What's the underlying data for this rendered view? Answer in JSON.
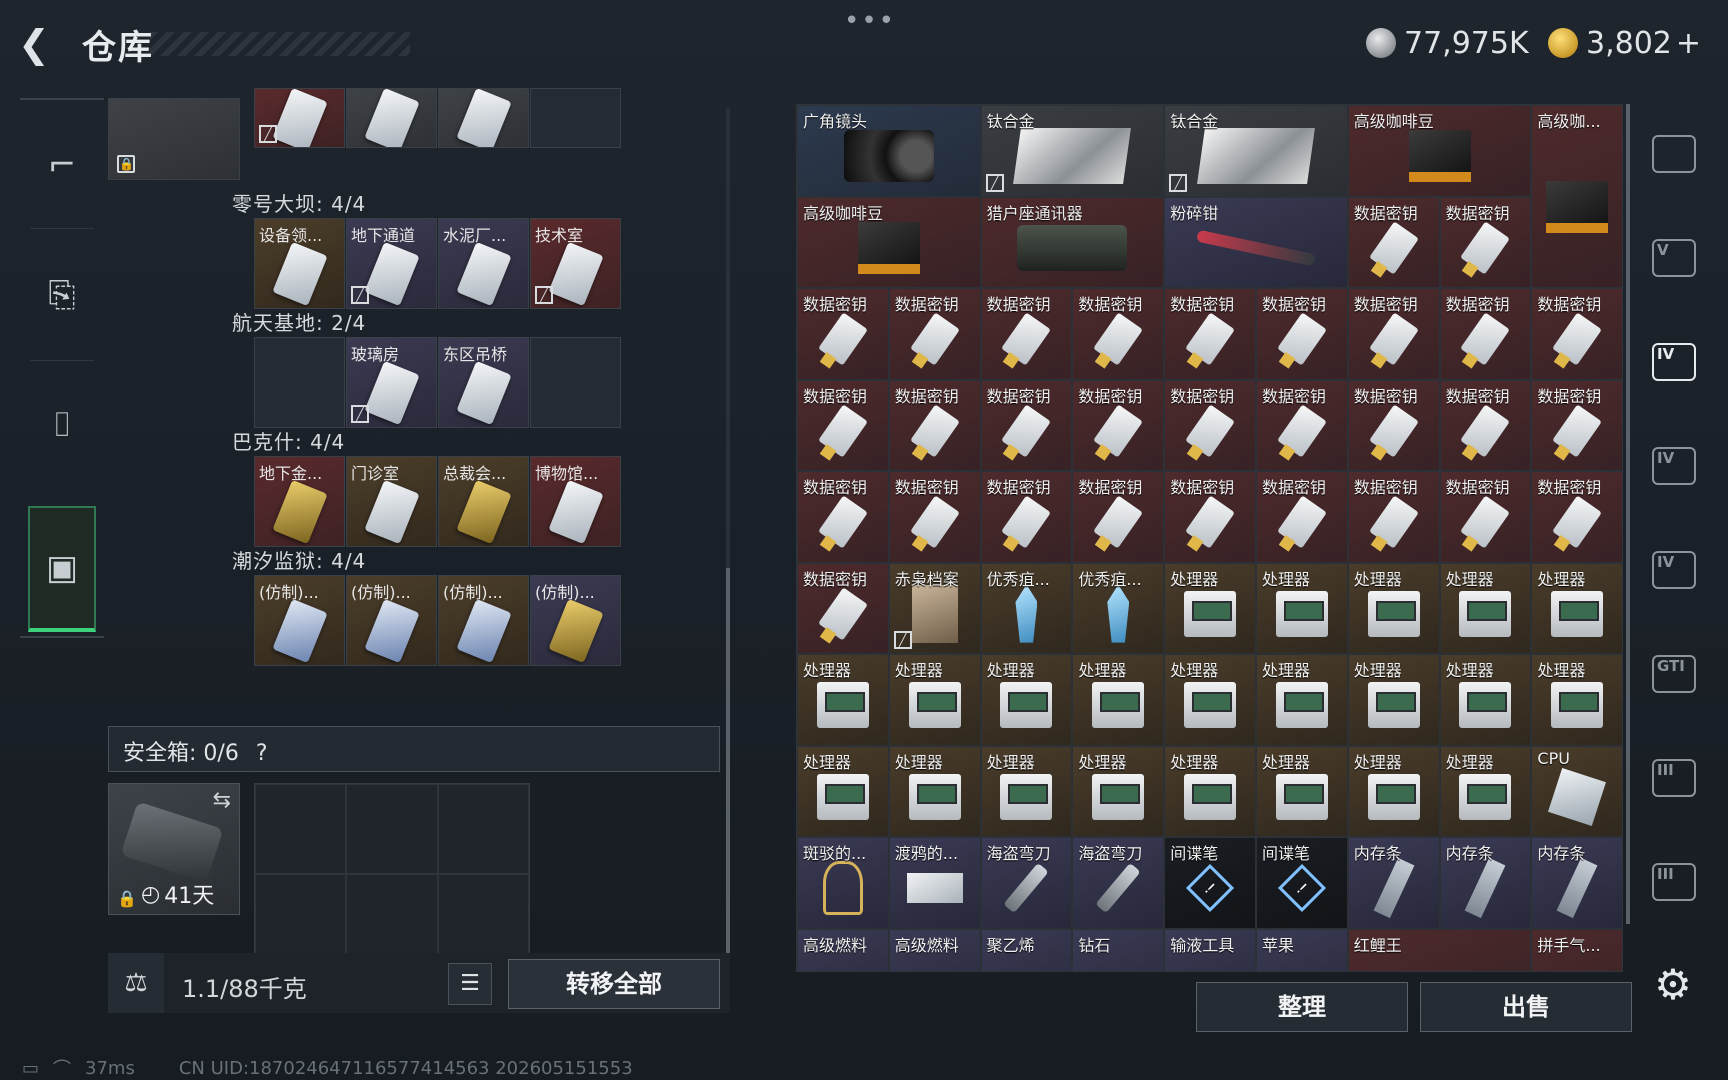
{
  "header": {
    "title": "仓库",
    "dots": "•••",
    "silver_amount": "77,975K",
    "gold_amount": "3,802",
    "gold_plus": "+"
  },
  "left_rail": {
    "items": [
      {
        "icon": "gun-icon"
      },
      {
        "icon": "backpack-icon"
      },
      {
        "icon": "vest-icon"
      },
      {
        "icon": "toolbox-icon",
        "active": true
      }
    ]
  },
  "key_groups": [
    {
      "title": "",
      "slots": [
        {
          "label": "",
          "color": "red",
          "nosign": true
        },
        {
          "label": "",
          "color": "gray"
        },
        {
          "label": "",
          "color": "gray"
        },
        {
          "label": "",
          "color": "empty"
        }
      ]
    },
    {
      "title": "零号大坝: 4/4",
      "slots": [
        {
          "label": "设备领...",
          "color": "gold"
        },
        {
          "label": "地下通道",
          "color": "purple",
          "nosign": true
        },
        {
          "label": "水泥厂...",
          "color": "purple"
        },
        {
          "label": "技术室",
          "color": "red",
          "nosign": true
        }
      ]
    },
    {
      "title": "航天基地: 2/4",
      "slots": [
        {
          "label": "",
          "color": "empty"
        },
        {
          "label": "玻璃房",
          "color": "purple",
          "nosign": true
        },
        {
          "label": "东区吊桥",
          "color": "purple"
        },
        {
          "label": "",
          "color": "empty"
        }
      ]
    },
    {
      "title": "巴克什: 4/4",
      "slots": [
        {
          "label": "地下金...",
          "color": "red",
          "card": "gold"
        },
        {
          "label": "门诊室",
          "color": "gold"
        },
        {
          "label": "总裁会...",
          "color": "gold",
          "card": "gold"
        },
        {
          "label": "博物馆...",
          "color": "red"
        }
      ]
    },
    {
      "title": "潮汐监狱: 4/4",
      "slots": [
        {
          "label": "(仿制)...",
          "color": "gold",
          "card": "blue"
        },
        {
          "label": "(仿制)...",
          "color": "gold",
          "card": "blue"
        },
        {
          "label": "(仿制)...",
          "color": "gold",
          "card": "blue"
        },
        {
          "label": "(仿制)...",
          "color": "purple",
          "card": "gold"
        }
      ]
    }
  ],
  "safe_box": {
    "label": "安全箱: 0/6",
    "help": "?",
    "days": "41天"
  },
  "footer_left": {
    "weight": "1.1/88千克",
    "transfer": "转移全部"
  },
  "grid_items": [
    {
      "label": "广角镜头",
      "icon": "lens",
      "bg": "blue",
      "c": 0,
      "r": 0,
      "w": 2,
      "h": 1
    },
    {
      "label": "钛合金",
      "icon": "foil",
      "bg": "gray",
      "c": 2,
      "r": 0,
      "w": 2,
      "h": 1,
      "nosign": true
    },
    {
      "label": "钛合金",
      "icon": "foil",
      "bg": "gray",
      "c": 4,
      "r": 0,
      "w": 2,
      "h": 1,
      "nosign": true
    },
    {
      "label": "高级咖啡豆",
      "icon": "bag",
      "bg": "red",
      "c": 6,
      "r": 0,
      "w": 2,
      "h": 1
    },
    {
      "label": "高级咖...",
      "icon": "bag",
      "bg": "red",
      "c": 8,
      "r": 0,
      "w": 1,
      "h": 2
    },
    {
      "label": "高级咖啡豆",
      "icon": "bag",
      "bg": "red",
      "c": 0,
      "r": 1,
      "w": 2,
      "h": 1
    },
    {
      "label": "猎户座通讯器",
      "icon": "radio",
      "bg": "red",
      "c": 2,
      "r": 1,
      "w": 2,
      "h": 1
    },
    {
      "label": "粉碎钳",
      "icon": "pliers",
      "bg": "purple",
      "c": 4,
      "r": 1,
      "w": 2,
      "h": 1
    },
    {
      "label": "数据密钥",
      "icon": "usb",
      "bg": "red",
      "c": 6,
      "r": 1
    },
    {
      "label": "数据密钥",
      "icon": "usb",
      "bg": "red",
      "c": 7,
      "r": 1
    },
    {
      "label": "数据密钥",
      "icon": "usb",
      "bg": "red",
      "c": 0,
      "r": 2
    },
    {
      "label": "数据密钥",
      "icon": "usb",
      "bg": "red",
      "c": 1,
      "r": 2
    },
    {
      "label": "数据密钥",
      "icon": "usb",
      "bg": "red",
      "c": 2,
      "r": 2
    },
    {
      "label": "数据密钥",
      "icon": "usb",
      "bg": "red",
      "c": 3,
      "r": 2
    },
    {
      "label": "数据密钥",
      "icon": "usb",
      "bg": "red",
      "c": 4,
      "r": 2
    },
    {
      "label": "数据密钥",
      "icon": "usb",
      "bg": "red",
      "c": 5,
      "r": 2
    },
    {
      "label": "数据密钥",
      "icon": "usb",
      "bg": "red",
      "c": 6,
      "r": 2
    },
    {
      "label": "数据密钥",
      "icon": "usb",
      "bg": "red",
      "c": 7,
      "r": 2
    },
    {
      "label": "数据密钥",
      "icon": "usb",
      "bg": "red",
      "c": 8,
      "r": 2
    },
    {
      "label": "数据密钥",
      "icon": "usb",
      "bg": "red",
      "c": 0,
      "r": 3
    },
    {
      "label": "数据密钥",
      "icon": "usb",
      "bg": "red",
      "c": 1,
      "r": 3
    },
    {
      "label": "数据密钥",
      "icon": "usb",
      "bg": "red",
      "c": 2,
      "r": 3
    },
    {
      "label": "数据密钥",
      "icon": "usb",
      "bg": "red",
      "c": 3,
      "r": 3
    },
    {
      "label": "数据密钥",
      "icon": "usb",
      "bg": "red",
      "c": 4,
      "r": 3
    },
    {
      "label": "数据密钥",
      "icon": "usb",
      "bg": "red",
      "c": 5,
      "r": 3
    },
    {
      "label": "数据密钥",
      "icon": "usb",
      "bg": "red",
      "c": 6,
      "r": 3
    },
    {
      "label": "数据密钥",
      "icon": "usb",
      "bg": "red",
      "c": 7,
      "r": 3
    },
    {
      "label": "数据密钥",
      "icon": "usb",
      "bg": "red",
      "c": 8,
      "r": 3
    },
    {
      "label": "数据密钥",
      "icon": "usb",
      "bg": "red",
      "c": 0,
      "r": 4
    },
    {
      "label": "数据密钥",
      "icon": "usb",
      "bg": "red",
      "c": 1,
      "r": 4
    },
    {
      "label": "数据密钥",
      "icon": "usb",
      "bg": "red",
      "c": 2,
      "r": 4
    },
    {
      "label": "数据密钥",
      "icon": "usb",
      "bg": "red",
      "c": 3,
      "r": 4
    },
    {
      "label": "数据密钥",
      "icon": "usb",
      "bg": "red",
      "c": 4,
      "r": 4
    },
    {
      "label": "数据密钥",
      "icon": "usb",
      "bg": "red",
      "c": 5,
      "r": 4
    },
    {
      "label": "数据密钥",
      "icon": "usb",
      "bg": "red",
      "c": 6,
      "r": 4
    },
    {
      "label": "数据密钥",
      "icon": "usb",
      "bg": "red",
      "c": 7,
      "r": 4
    },
    {
      "label": "数据密钥",
      "icon": "usb",
      "bg": "red",
      "c": 8,
      "r": 4
    },
    {
      "label": "数据密钥",
      "icon": "usb",
      "bg": "red",
      "c": 0,
      "r": 5
    },
    {
      "label": "赤枭档案",
      "icon": "doc",
      "bg": "gold",
      "c": 1,
      "r": 5,
      "nosign": true
    },
    {
      "label": "优秀疽...",
      "icon": "crystal",
      "bg": "gold",
      "c": 2,
      "r": 5
    },
    {
      "label": "优秀疽...",
      "icon": "crystal",
      "bg": "gold",
      "c": 3,
      "r": 5
    },
    {
      "label": "处理器",
      "icon": "proc",
      "bg": "gold",
      "c": 4,
      "r": 5
    },
    {
      "label": "处理器",
      "icon": "proc",
      "bg": "gold",
      "c": 5,
      "r": 5
    },
    {
      "label": "处理器",
      "icon": "proc",
      "bg": "gold",
      "c": 6,
      "r": 5
    },
    {
      "label": "处理器",
      "icon": "proc",
      "bg": "gold",
      "c": 7,
      "r": 5
    },
    {
      "label": "处理器",
      "icon": "proc",
      "bg": "gold",
      "c": 8,
      "r": 5
    },
    {
      "label": "处理器",
      "icon": "proc",
      "bg": "gold",
      "c": 0,
      "r": 6
    },
    {
      "label": "处理器",
      "icon": "proc",
      "bg": "gold",
      "c": 1,
      "r": 6
    },
    {
      "label": "处理器",
      "icon": "proc",
      "bg": "gold",
      "c": 2,
      "r": 6
    },
    {
      "label": "处理器",
      "icon": "proc",
      "bg": "gold",
      "c": 3,
      "r": 6
    },
    {
      "label": "处理器",
      "icon": "proc",
      "bg": "gold",
      "c": 4,
      "r": 6
    },
    {
      "label": "处理器",
      "icon": "proc",
      "bg": "gold",
      "c": 5,
      "r": 6
    },
    {
      "label": "处理器",
      "icon": "proc",
      "bg": "gold",
      "c": 6,
      "r": 6
    },
    {
      "label": "处理器",
      "icon": "proc",
      "bg": "gold",
      "c": 7,
      "r": 6
    },
    {
      "label": "处理器",
      "icon": "proc",
      "bg": "gold",
      "c": 8,
      "r": 6
    },
    {
      "label": "处理器",
      "icon": "proc",
      "bg": "gold",
      "c": 0,
      "r": 7
    },
    {
      "label": "处理器",
      "icon": "proc",
      "bg": "gold",
      "c": 1,
      "r": 7
    },
    {
      "label": "处理器",
      "icon": "proc",
      "bg": "gold",
      "c": 2,
      "r": 7
    },
    {
      "label": "处理器",
      "icon": "proc",
      "bg": "gold",
      "c": 3,
      "r": 7
    },
    {
      "label": "处理器",
      "icon": "proc",
      "bg": "gold",
      "c": 4,
      "r": 7
    },
    {
      "label": "处理器",
      "icon": "proc",
      "bg": "gold",
      "c": 5,
      "r": 7
    },
    {
      "label": "处理器",
      "icon": "proc",
      "bg": "gold",
      "c": 6,
      "r": 7
    },
    {
      "label": "处理器",
      "icon": "proc",
      "bg": "gold",
      "c": 7,
      "r": 7
    },
    {
      "label": "CPU",
      "icon": "cpu",
      "bg": "gold",
      "c": 8,
      "r": 7
    },
    {
      "label": "斑驳的...",
      "icon": "skull",
      "bg": "purple",
      "c": 0,
      "r": 8
    },
    {
      "label": "渡鸦的...",
      "icon": "crow",
      "bg": "purple",
      "c": 1,
      "r": 8
    },
    {
      "label": "海盗弯刀",
      "icon": "blade",
      "bg": "purple",
      "c": 2,
      "r": 8
    },
    {
      "label": "海盗弯刀",
      "icon": "blade",
      "bg": "purple",
      "c": 3,
      "r": 8
    },
    {
      "label": "间谍笔",
      "icon": "spy",
      "bg": "dark",
      "c": 4,
      "r": 8
    },
    {
      "label": "间谍笔",
      "icon": "spy",
      "bg": "dark",
      "c": 5,
      "r": 8
    },
    {
      "label": "内存条",
      "icon": "ram",
      "bg": "purple",
      "c": 6,
      "r": 8
    },
    {
      "label": "内存条",
      "icon": "ram",
      "bg": "purple",
      "c": 7,
      "r": 8
    },
    {
      "label": "内存条",
      "icon": "ram",
      "bg": "purple",
      "c": 8,
      "r": 8
    },
    {
      "label": "高级燃料",
      "icon": "none",
      "bg": "purple",
      "c": 0,
      "r": 9
    },
    {
      "label": "高级燃料",
      "icon": "none",
      "bg": "purple",
      "c": 1,
      "r": 9
    },
    {
      "label": "聚乙烯",
      "icon": "none",
      "bg": "purple",
      "c": 2,
      "r": 9
    },
    {
      "label": "钻石",
      "icon": "none",
      "bg": "purple",
      "c": 3,
      "r": 9
    },
    {
      "label": "输液工具",
      "icon": "none",
      "bg": "purple",
      "c": 4,
      "r": 9
    },
    {
      "label": "苹果",
      "icon": "none",
      "bg": "purple",
      "c": 5,
      "r": 9
    },
    {
      "label": "红鲤王",
      "icon": "none",
      "bg": "red",
      "c": 6,
      "r": 9,
      "w": 2
    },
    {
      "label": "拼手气...",
      "icon": "none",
      "bg": "red",
      "c": 8,
      "r": 9
    }
  ],
  "footer_right": {
    "sort": "整理",
    "sell": "出售"
  },
  "right_rail": {
    "items": [
      {
        "icon": "helmet-icon",
        "text": ""
      },
      {
        "icon": "tier-v-icon",
        "text": "V"
      },
      {
        "icon": "tier-iv-active-icon",
        "text": "IV"
      },
      {
        "icon": "tier-iv-case-icon",
        "text": "IV"
      },
      {
        "icon": "tier-iv-box-icon",
        "text": "IV"
      },
      {
        "icon": "gti-icon",
        "text": "GTI"
      },
      {
        "icon": "tier-iii-icon",
        "text": "III"
      },
      {
        "icon": "tier-iii-box-icon",
        "text": "III"
      }
    ]
  },
  "status_bar": {
    "ping": "37ms",
    "uid": "CN UID:18702464711657741456​3 202605151553"
  }
}
